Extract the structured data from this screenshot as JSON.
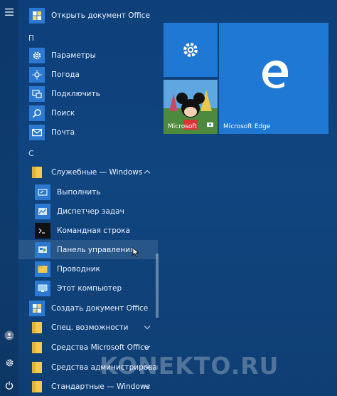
{
  "app_list": {
    "items": [
      {
        "label": "Открыть документ Office"
      },
      {
        "letter": "П"
      },
      {
        "label": "Параметры"
      },
      {
        "label": "Погода"
      },
      {
        "label": "Подключить"
      },
      {
        "label": "Поиск"
      },
      {
        "label": "Почта"
      },
      {
        "letter": "С"
      },
      {
        "label": "Служебные — Windows"
      },
      {
        "label": "Выполнить"
      },
      {
        "label": "Диспетчер задач"
      },
      {
        "label": "Командная строка"
      },
      {
        "label": "Панель управления"
      },
      {
        "label": "Проводник"
      },
      {
        "label": "Этот компьютер"
      },
      {
        "label": "Создать документ Office"
      },
      {
        "label": "Спец. возможности"
      },
      {
        "label": "Средства Microsoft Office"
      },
      {
        "label": "Средства администрирования..."
      },
      {
        "label": "Стандартные — Windows"
      }
    ]
  },
  "tiles": {
    "settings": {
      "label": ""
    },
    "photos": {
      "label": "Microsoft"
    },
    "edge": {
      "label": "Microsoft Edge"
    }
  },
  "watermark": "KONEKTO.RU",
  "colors": {
    "tile": "#1e78d4",
    "menu_bg": "#0f3e73",
    "folder": "#f3c94e"
  },
  "icons": {
    "rail": [
      "hamburger-icon",
      "user-icon",
      "gear-icon",
      "power-icon"
    ]
  }
}
